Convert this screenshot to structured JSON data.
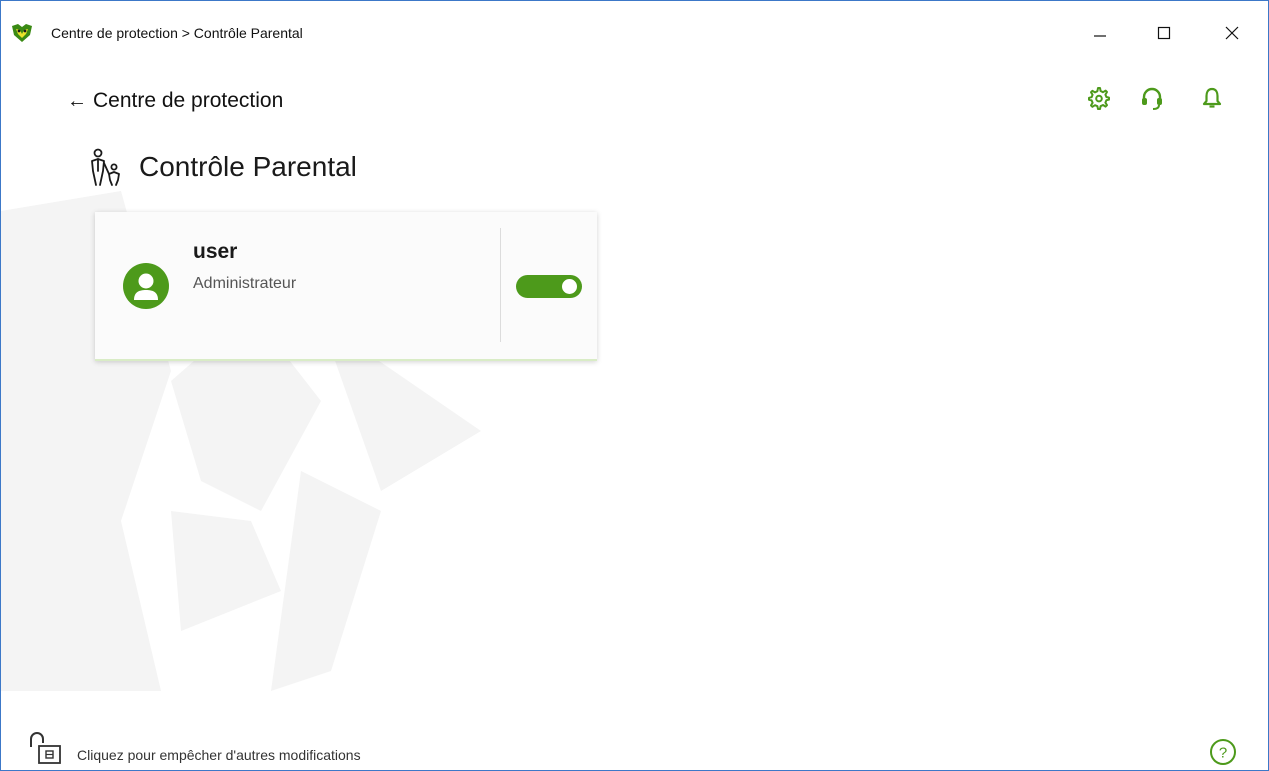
{
  "window": {
    "title": "Centre de protection > Contrôle Parental",
    "minimize_icon": "minimize-icon",
    "maximize_icon": "maximize-icon",
    "close_icon": "close-icon"
  },
  "toolbar": {
    "settings_icon": "gear-icon",
    "support_icon": "headset-icon",
    "notifications_icon": "bell-icon"
  },
  "nav": {
    "back_label": "Centre de protection",
    "back_icon": "arrow-left-icon"
  },
  "page": {
    "title": "Contrôle Parental",
    "icon": "parent-child-icon"
  },
  "users": [
    {
      "name": "user",
      "role": "Administrateur",
      "enabled": true
    }
  ],
  "footer": {
    "lock_text": "Cliquez pour empêcher d'autres modifications",
    "lock_icon": "unlocked-padlock-icon",
    "help_icon": "help-icon"
  },
  "colors": {
    "accent": "#4d9a1b",
    "window_border": "#3c78c8",
    "watermark": "#f5f5f5"
  }
}
